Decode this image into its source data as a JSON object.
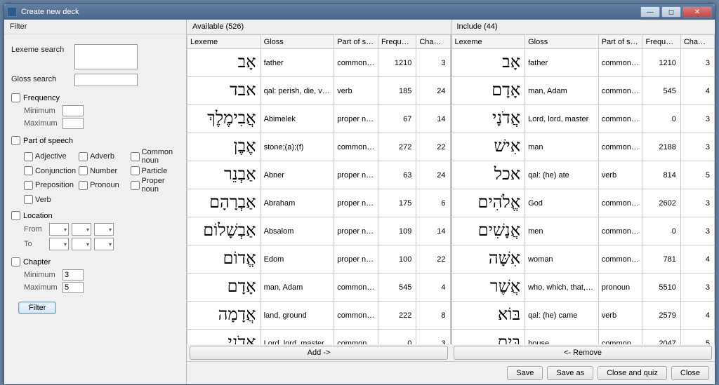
{
  "window": {
    "title": "Create new deck"
  },
  "filter": {
    "panel_title": "Filter",
    "lexeme_label": "Lexeme search",
    "gloss_label": "Gloss search",
    "freq": {
      "label": "Frequency",
      "min_label": "Minimum",
      "max_label": "Maximum",
      "min": "",
      "max": ""
    },
    "pos": {
      "label": "Part of speech",
      "options": [
        "Adjective",
        "Adverb",
        "Common noun",
        "Conjunction",
        "Number",
        "Particle",
        "Preposition",
        "Pronoun",
        "Proper noun",
        "Verb"
      ]
    },
    "loc": {
      "label": "Location",
      "from_label": "From",
      "to_label": "To"
    },
    "chapter": {
      "label": "Chapter",
      "min_label": "Minimum",
      "max_label": "Maximum",
      "min": "3",
      "max": "5"
    },
    "button": "Filter"
  },
  "available": {
    "title": "Available (526)",
    "headers": [
      "Lexeme",
      "Gloss",
      "Part of sp...",
      "Frequency",
      "Chapter"
    ],
    "rows": [
      {
        "lex": "אָב",
        "gloss": "father",
        "pos": "common noun",
        "freq": 1210,
        "ch": 3
      },
      {
        "lex": "אבד",
        "gloss": "qal: perish, die, vanish;;...",
        "pos": "verb",
        "freq": 185,
        "ch": 24
      },
      {
        "lex": "אֲבִימֶלֶךְ",
        "gloss": "Abimelek",
        "pos": "proper noun",
        "freq": 67,
        "ch": 14
      },
      {
        "lex": "אֶבֶן",
        "gloss": "stone;(a);(f)",
        "pos": "common noun",
        "freq": 272,
        "ch": 22
      },
      {
        "lex": "אַבְנֵר",
        "gloss": "Abner",
        "pos": "proper noun",
        "freq": 63,
        "ch": 24
      },
      {
        "lex": "אַבְרָהָם",
        "gloss": "Abraham",
        "pos": "proper noun",
        "freq": 175,
        "ch": 6
      },
      {
        "lex": "אַבְשָׁלוֹם",
        "gloss": "Absalom",
        "pos": "proper noun",
        "freq": 109,
        "ch": 14
      },
      {
        "lex": "אֱדוֹם",
        "gloss": "Edom",
        "pos": "proper noun",
        "freq": 100,
        "ch": 22
      },
      {
        "lex": "אָדָם",
        "gloss": "man, Adam",
        "pos": "common noun",
        "freq": 545,
        "ch": 4
      },
      {
        "lex": "אֲדָמָה",
        "gloss": "land, ground",
        "pos": "common noun",
        "freq": 222,
        "ch": 8
      },
      {
        "lex": "אֲדֹנָי",
        "gloss": "Lord, lord, master",
        "pos": "common no...",
        "freq": 0,
        "ch": 3
      }
    ],
    "add_button": "Add ->"
  },
  "include": {
    "title": "Include (44)",
    "headers": [
      "Lexeme",
      "Gloss",
      "Part of sp...",
      "Frequency",
      "Chapter"
    ],
    "rows": [
      {
        "lex": "אָב",
        "gloss": "father",
        "pos": "common noun",
        "freq": 1210,
        "ch": 3
      },
      {
        "lex": "אָדָם",
        "gloss": "man, Adam",
        "pos": "common noun",
        "freq": 545,
        "ch": 4
      },
      {
        "lex": "אֲדֹנָי",
        "gloss": "Lord, lord, master",
        "pos": "common no...",
        "freq": 0,
        "ch": 3
      },
      {
        "lex": "אִישׁ",
        "gloss": "man",
        "pos": "common noun",
        "freq": 2188,
        "ch": 3
      },
      {
        "lex": "אכל",
        "gloss": "qal: (he) ate",
        "pos": "verb",
        "freq": 814,
        "ch": 5
      },
      {
        "lex": "אֱלֹהִים",
        "gloss": "God",
        "pos": "common noun",
        "freq": 2602,
        "ch": 3
      },
      {
        "lex": "אֲנָשִׁים",
        "gloss": "men",
        "pos": "common noun",
        "freq": 0,
        "ch": 3
      },
      {
        "lex": "אִשָּׁה",
        "gloss": "woman",
        "pos": "common noun",
        "freq": 781,
        "ch": 4
      },
      {
        "lex": "אֲשֶׁר",
        "gloss": "who, which, that, that ...",
        "pos": "pronoun",
        "freq": 5510,
        "ch": 3
      },
      {
        "lex": "בּוֹא",
        "gloss": "qal: (he) came",
        "pos": "verb",
        "freq": 2579,
        "ch": 4
      },
      {
        "lex": "בַּיִת",
        "gloss": "house",
        "pos": "common noun",
        "freq": 2047,
        "ch": 5
      }
    ],
    "remove_button": "<- Remove"
  },
  "buttons": {
    "save": "Save",
    "save_as": "Save as",
    "close_quiz": "Close and quiz",
    "close": "Close"
  }
}
